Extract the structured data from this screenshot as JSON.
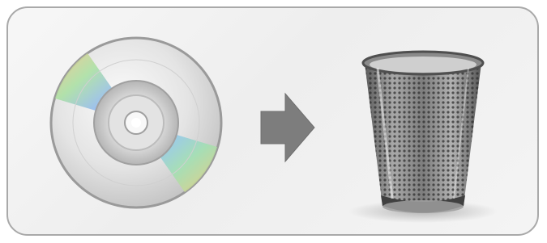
{
  "dialog": {
    "source_icon": "optical-disc-icon",
    "action_icon": "right-arrow-icon",
    "target_icon": "trash-can-icon"
  },
  "colors": {
    "panel_border": "#a9a9a9",
    "panel_background": "#f2f2f2",
    "arrow": "#7d7d7d",
    "disc_silver": "#d8d8d8"
  }
}
